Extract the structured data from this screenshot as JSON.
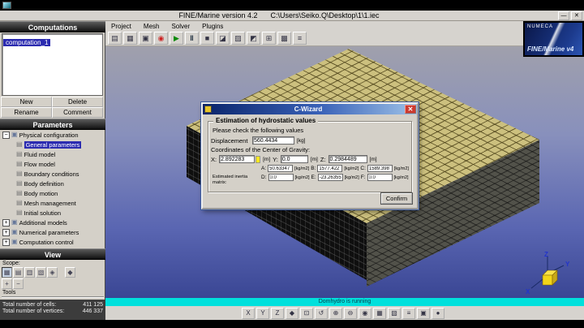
{
  "window": {
    "title": "FINE/Marine version 4.2",
    "path": "C:\\Users\\Seiko.Q\\Desktop\\1\\1.iec"
  },
  "menu": {
    "items": [
      "Project",
      "Mesh",
      "Solver",
      "Plugins"
    ]
  },
  "computations": {
    "header": "Computations",
    "items": [
      "computation_1"
    ],
    "new_label": "New",
    "delete_label": "Delete",
    "rename_label": "Rename",
    "comment_label": "Comment"
  },
  "parameters": {
    "header": "Parameters",
    "tree": [
      {
        "label": "Physical configuration"
      },
      {
        "label": "General parameters"
      },
      {
        "label": "Fluid model"
      },
      {
        "label": "Flow model"
      },
      {
        "label": "Boundary conditions"
      },
      {
        "label": "Body definition"
      },
      {
        "label": "Body motion"
      },
      {
        "label": "Mesh management"
      },
      {
        "label": "Initial solution"
      },
      {
        "label": "Additional models"
      },
      {
        "label": "Numerical parameters"
      },
      {
        "label": "Computation control"
      }
    ]
  },
  "view_panel": {
    "header": "View",
    "scope_label": "Scope:",
    "tools_label": "Tools"
  },
  "mesh_stats": {
    "cells_label": "Total number of cells:",
    "cells_value": "411 125",
    "vertices_label": "Total number of vertices:",
    "vertices_value": "446 337"
  },
  "statusbar": {
    "message": "Domhydro is running"
  },
  "logo": {
    "brand": "NUMECA",
    "product": "FINE/Marine v4"
  },
  "axis": {
    "x": "X",
    "y": "Y",
    "z": "Z"
  },
  "dialog": {
    "title": "C-Wizard",
    "group_title": "Estimation of hydrostatic values",
    "subtitle": "Please check the following values",
    "displacement_label": "Displacement",
    "displacement_value": "560.4434",
    "displacement_unit": "[kg]",
    "cog_label": "Coordinates of the Center of Gravity:",
    "cog": [
      {
        "label": "X:",
        "value": "2.892283",
        "unit": "[m]"
      },
      {
        "label": "Y:",
        "value": "0.0",
        "unit": "[m]"
      },
      {
        "label": "Z:",
        "value": "0.2984489",
        "unit": "[m]"
      }
    ],
    "inertia_label": "Estimated inertia matrix:",
    "inertia_row1": [
      {
        "label": "A:",
        "value": "50.63347",
        "unit": "[kg/m2]"
      },
      {
        "label": "B:",
        "value": "1577.422",
        "unit": "[kg/m2]"
      },
      {
        "label": "C:",
        "value": "1589.398",
        "unit": "[kg/m2]"
      }
    ],
    "inertia_row2": [
      {
        "label": "D:",
        "value": "0.0",
        "unit": "[kg/m2]"
      },
      {
        "label": "E:",
        "value": "-23.26355",
        "unit": "[kg/m2]"
      },
      {
        "label": "F:",
        "value": "0.0",
        "unit": "[kg/m2]"
      }
    ],
    "confirm_label": "Confirm"
  },
  "icons": {
    "minimize": "—",
    "close": "✕",
    "dialog_close": "✕",
    "new_document": "▤",
    "open_folder": "▦",
    "save": "▣",
    "live_update": "◉",
    "start_computation": "▶",
    "pause_computation": "‖",
    "stop_computation": "■",
    "cut_plane": "◪",
    "mesh_view": "▨",
    "plot": "◩",
    "probe": "⊞",
    "grid": "▩",
    "table": "≡",
    "expander_open": "−",
    "expander_closed": "+",
    "folder": "▣",
    "page": "▤",
    "scope_1": "▦",
    "scope_2": "▤",
    "scope_3": "▥",
    "scope_4": "▧",
    "scope_5": "◈",
    "scope_diamond": "◆",
    "scope_plus": "+",
    "scope_minus": "−",
    "view_x": "X",
    "view_y": "Y",
    "view_z": "Z",
    "view_iso": "◆",
    "fit_view": "⊡",
    "rotate_view": "↺",
    "zoom_in": "⊕",
    "zoom_out": "⊖",
    "center_view": "◉",
    "grid_toggle": "▦",
    "shade_toggle": "▧",
    "list_view": "≡",
    "snapshot": "▣",
    "point_probe": "●"
  },
  "colors": {
    "titlebar_blue": "#0a246a",
    "selection_blue": "#2b2bb0",
    "statusbar_cyan": "#00e0dc",
    "mesh_tan": "#ccc07e",
    "close_red": "#cc3a30",
    "cube_yellow": "#f2d51a"
  }
}
